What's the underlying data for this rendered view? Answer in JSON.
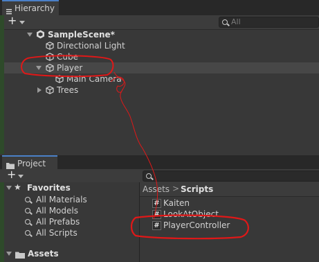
{
  "hierarchy": {
    "tab_label": "Hierarchy",
    "add_label": "+",
    "search_placeholder": "All",
    "scene_name": "SampleScene*",
    "items": {
      "directional_light": "Directional Light",
      "cube": "Cube",
      "player": "Player",
      "main_camera": "Main Camera",
      "trees": "Trees"
    }
  },
  "project": {
    "tab_label": "Project",
    "add_label": "+",
    "favorites": {
      "title": "Favorites",
      "items": [
        "All Materials",
        "All Models",
        "All Prefabs",
        "All Scripts"
      ]
    },
    "assets_label": "Assets",
    "breadcrumb": {
      "root": "Assets",
      "separator": ">",
      "current": "Scripts"
    },
    "scripts": [
      "Kaiten",
      "LookAtObject",
      "PlayerController"
    ]
  },
  "colors": {
    "panel_bg": "#383838",
    "selected_row": "#474747",
    "annotation_red": "#e01818",
    "tab_accent": "#4a80c8"
  }
}
